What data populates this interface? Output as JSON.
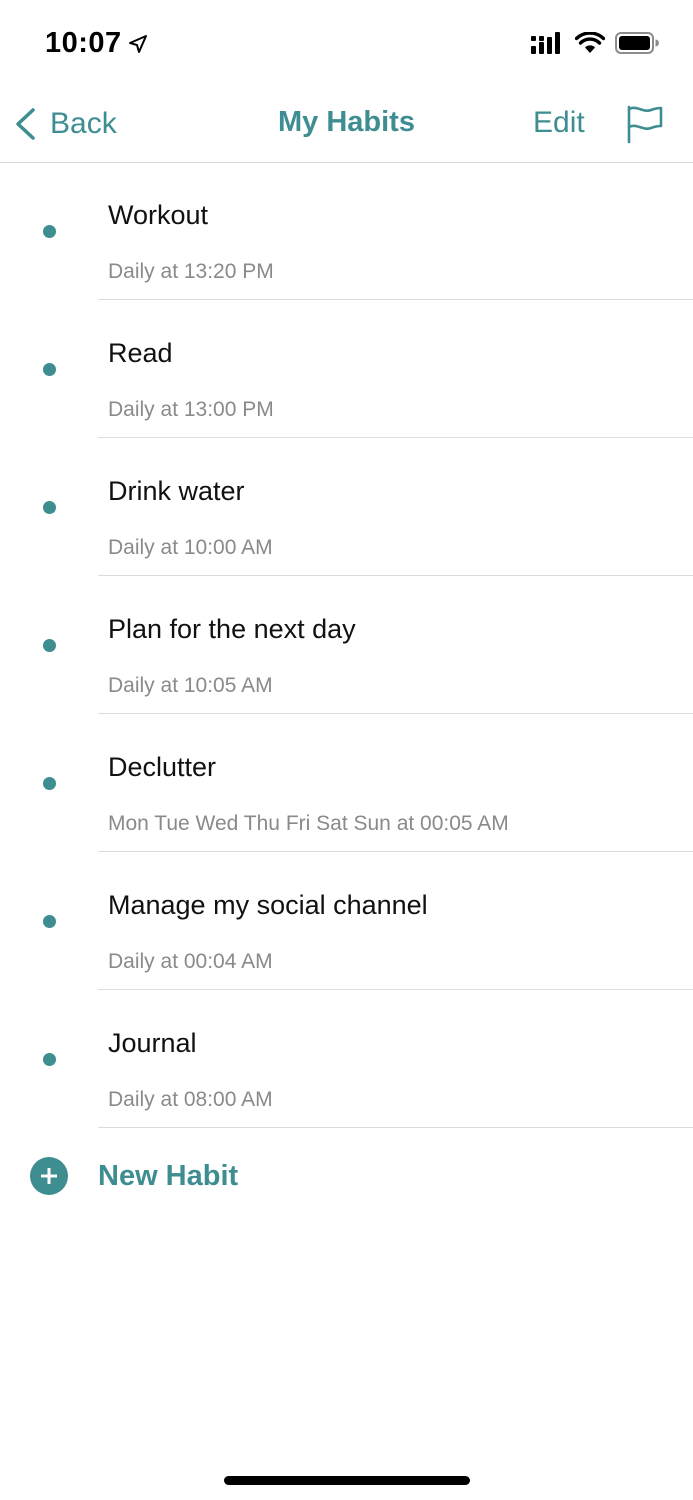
{
  "status_bar": {
    "time": "10:07",
    "location_icon": "location-arrow-icon",
    "signal_icon": "cellular-signal-icon",
    "wifi_icon": "wifi-icon",
    "battery_icon": "battery-icon"
  },
  "nav": {
    "back_label": "Back",
    "title": "My Habits",
    "edit_label": "Edit",
    "flag_icon": "flag-icon"
  },
  "habits": [
    {
      "name": "Workout",
      "schedule": "Daily at 13:20 PM"
    },
    {
      "name": "Read",
      "schedule": "Daily at 13:00 PM"
    },
    {
      "name": "Drink water",
      "schedule": "Daily at 10:00 AM"
    },
    {
      "name": "Plan for the next day",
      "schedule": "Daily at 10:05 AM"
    },
    {
      "name": "Declutter",
      "schedule": "Mon Tue Wed Thu Fri Sat Sun at 00:05 AM"
    },
    {
      "name": "Manage my social channel",
      "schedule": "Daily at 00:04 AM"
    },
    {
      "name": "Journal",
      "schedule": "Daily at 08:00 AM"
    }
  ],
  "new_habit": {
    "label": "New Habit",
    "icon": "plus-circle-icon"
  },
  "colors": {
    "accent": "#3d8d91",
    "secondary_text": "#8a8a8a",
    "divider": "#dcdcdc"
  }
}
